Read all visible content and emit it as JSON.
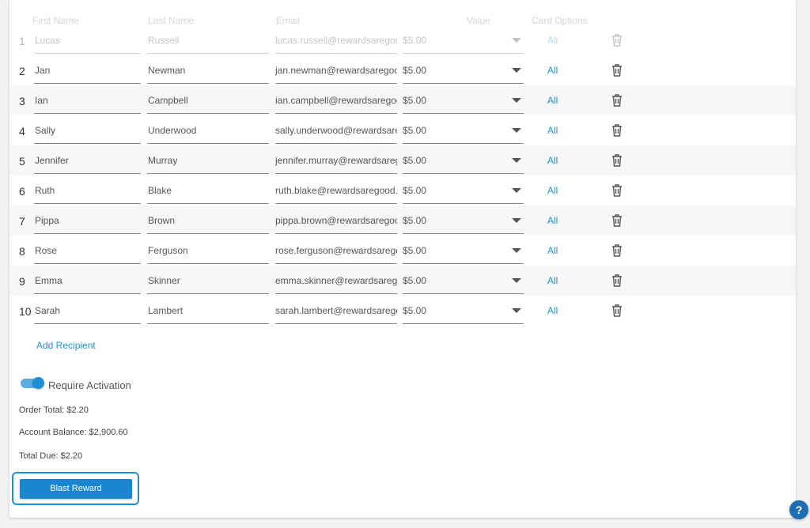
{
  "headers": {
    "first_name": "First Name",
    "last_name": "Last Name",
    "email": "Email",
    "value": "Value",
    "card_options": "Card Options"
  },
  "recipients": [
    {
      "index": "1",
      "first": "Lucas",
      "last": "Russell",
      "email": "lucas.russell@rewardsaregood.com",
      "value": "$5.00",
      "options": "All"
    },
    {
      "index": "2",
      "first": "Jan",
      "last": "Newman",
      "email": "jan.newman@rewardsaregood.com",
      "value": "$5.00",
      "options": "All"
    },
    {
      "index": "3",
      "first": "Ian",
      "last": "Campbell",
      "email": "ian.campbell@rewardsaregood.com",
      "value": "$5.00",
      "options": "All"
    },
    {
      "index": "4",
      "first": "Sally",
      "last": "Underwood",
      "email": "sally.underwood@rewardsaregood.com",
      "value": "$5.00",
      "options": "All"
    },
    {
      "index": "5",
      "first": "Jennifer",
      "last": "Murray",
      "email": "jennifer.murray@rewardsaregood.com",
      "value": "$5.00",
      "options": "All"
    },
    {
      "index": "6",
      "first": "Ruth",
      "last": "Blake",
      "email": "ruth.blake@rewardsaregood.com",
      "value": "$5.00",
      "options": "All"
    },
    {
      "index": "7",
      "first": "Pippa",
      "last": "Brown",
      "email": "pippa.brown@rewardsaregood.com",
      "value": "$5.00",
      "options": "All"
    },
    {
      "index": "8",
      "first": "Rose",
      "last": "Ferguson",
      "email": "rose.ferguson@rewardsaregood.com",
      "value": "$5.00",
      "options": "All"
    },
    {
      "index": "9",
      "first": "Emma",
      "last": "Skinner",
      "email": "emma.skinner@rewardsaregood.com",
      "value": "$5.00",
      "options": "All"
    },
    {
      "index": "10",
      "first": "Sarah",
      "last": "Lambert",
      "email": "sarah.lambert@rewardsaregood.com",
      "value": "$5.00",
      "options": "All"
    }
  ],
  "add_recipient_label": "Add Recipient",
  "require_activation": {
    "label": "Require Activation",
    "enabled": true
  },
  "summary": {
    "order_total": "Order Total: $2.20",
    "account_balance": "Account Balance: $2,900.60",
    "total_due": "Total Due: $2.20"
  },
  "blast_button_label": "Blast Reward",
  "help_label": "?",
  "icons": {
    "trash": "trash-icon",
    "caret": "caret-down-icon",
    "help": "help-icon"
  },
  "colors": {
    "accent": "#1f8fd4",
    "button": "#1a86d0",
    "help": "#1c6fb5"
  }
}
